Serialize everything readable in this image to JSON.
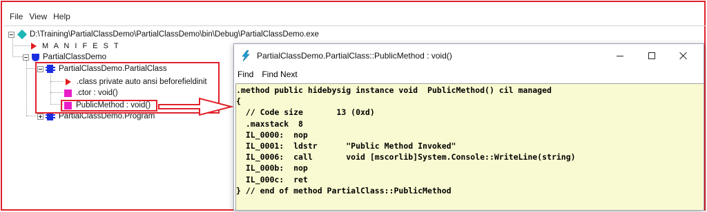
{
  "app": {
    "menus": [
      "File",
      "View",
      "Help"
    ]
  },
  "tree": {
    "root_path": "D:\\Training\\PartialClassDemo\\PartialClassDemo\\bin\\Debug\\PartialClassDemo.exe",
    "manifest": "M A N I F E S T",
    "namespace": "PartialClassDemo",
    "partial_class": "PartialClassDemo.PartialClass",
    "members": [
      ".class private auto ansi beforefieldinit",
      ".ctor : void()",
      "PublicMethod : void()"
    ],
    "program_class": "PartialClassDemo.Program"
  },
  "ildasm_window": {
    "title": "PartialClassDemo.PartialClass::PublicMethod : void()",
    "menus": [
      "Find",
      "Find Next"
    ],
    "code_lines": [
      ".method public hidebysig instance void  PublicMethod() cil managed",
      "{",
      "  // Code size       13 (0xd)",
      "  .maxstack  8",
      "  IL_0000:  nop",
      "  IL_0001:  ldstr      \"Public Method Invoked\"",
      "  IL_0006:  call       void [mscorlib]System.Console::WriteLine(string)",
      "  IL_000b:  nop",
      "  IL_000c:  ret",
      "} // end of method PartialClass::PublicMethod"
    ]
  },
  "colors": {
    "annotation_red": "#e0202a",
    "code_background": "#fafad2",
    "class_icon": "#1a2ee0",
    "method_icon": "#e91ec9"
  }
}
